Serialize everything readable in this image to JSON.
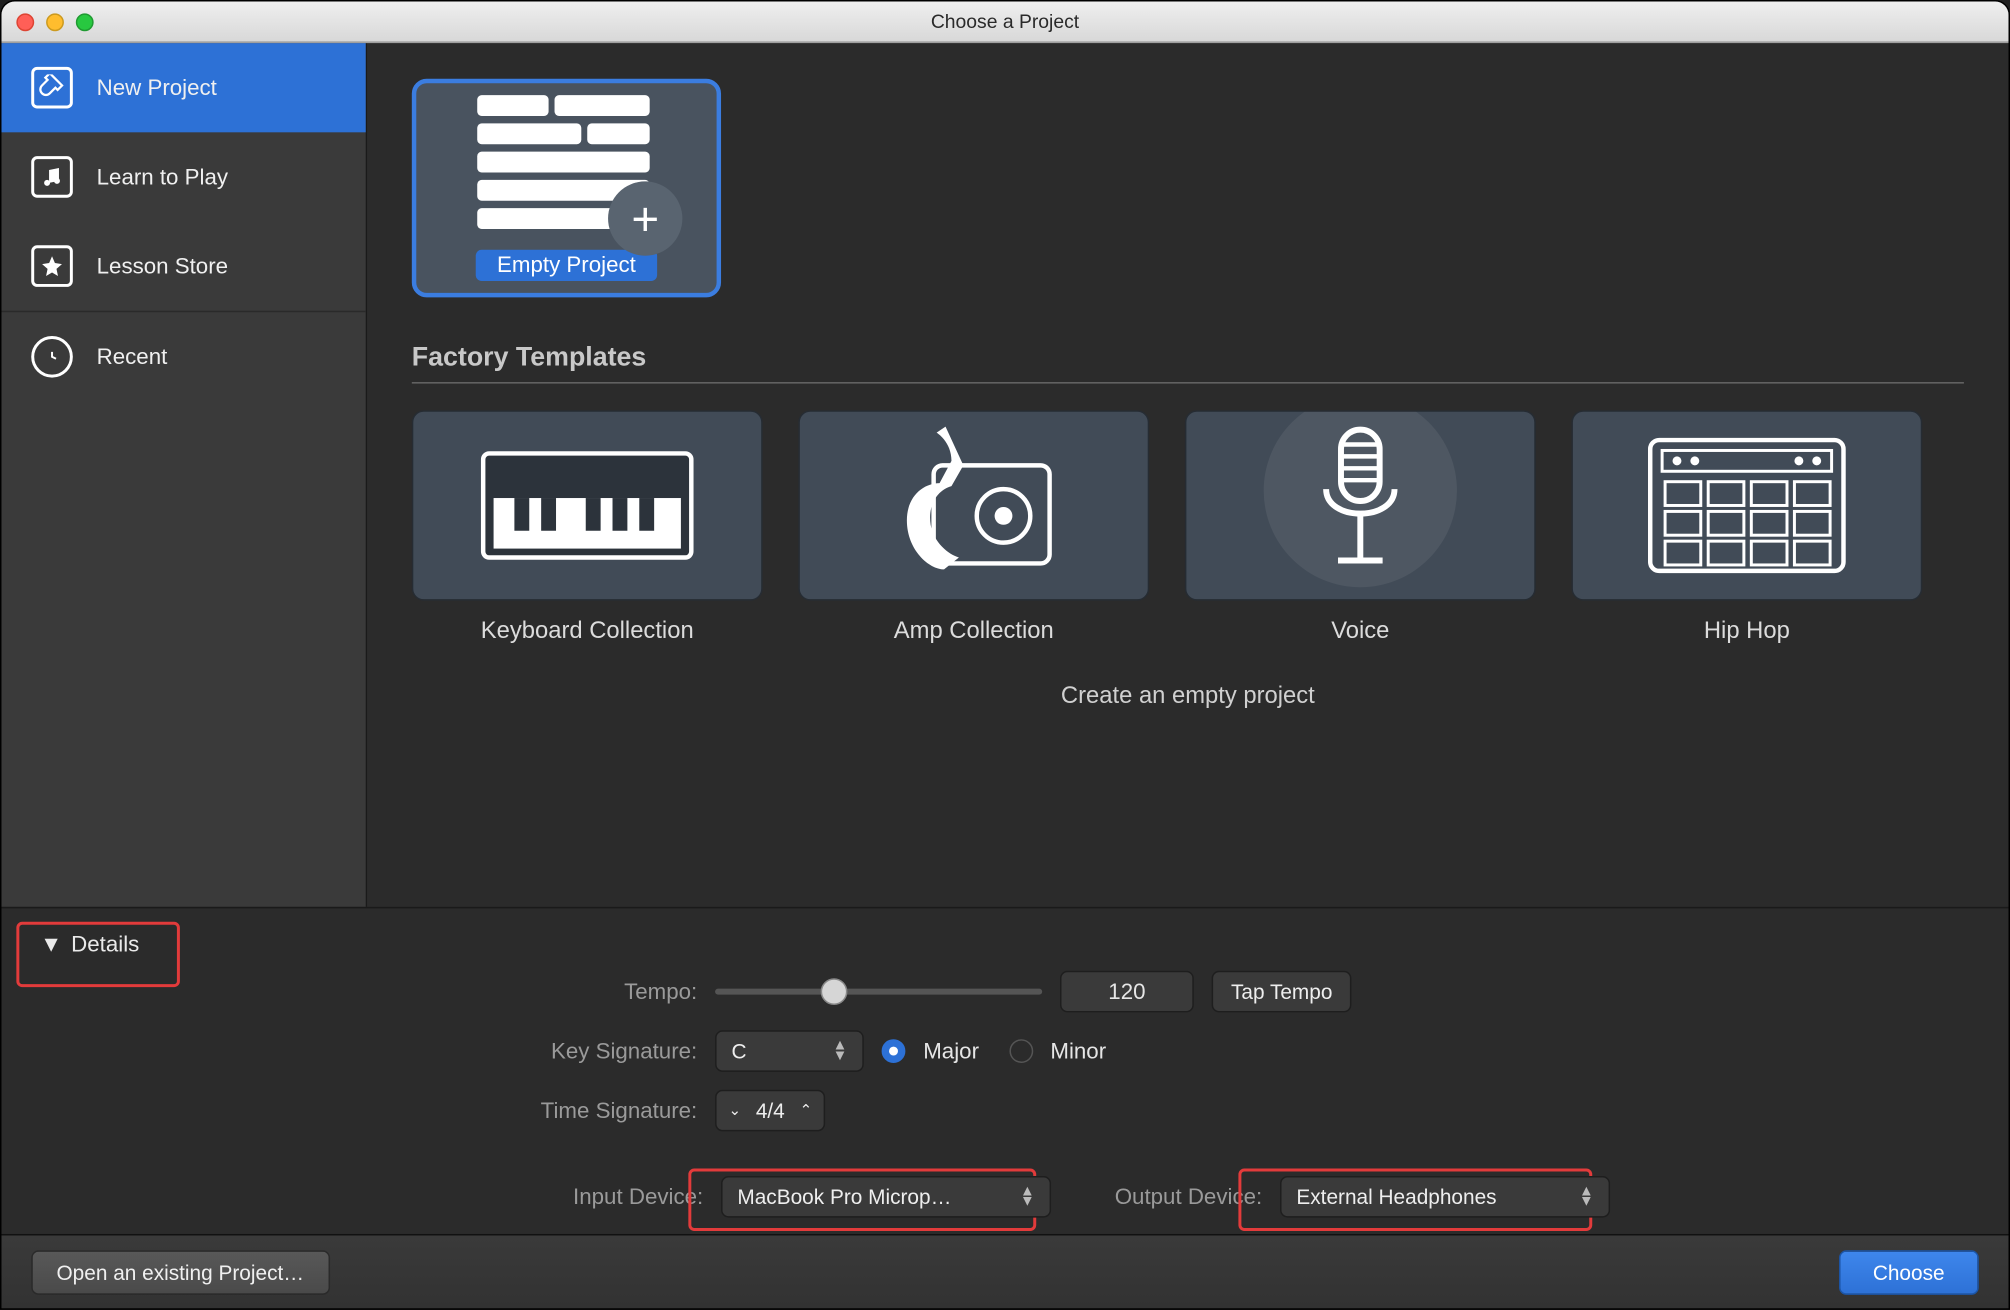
{
  "window": {
    "title": "Choose a Project"
  },
  "sidebar": {
    "items": [
      {
        "label": "New Project",
        "icon": "guitar-icon"
      },
      {
        "label": "Learn to Play",
        "icon": "note-icon"
      },
      {
        "label": "Lesson Store",
        "icon": "star-icon"
      },
      {
        "label": "Recent",
        "icon": "clock-icon"
      }
    ]
  },
  "selected_tile": {
    "label": "Empty Project"
  },
  "factory": {
    "heading": "Factory Templates",
    "templates": [
      {
        "label": "Keyboard Collection",
        "icon": "keyboard-icon"
      },
      {
        "label": "Amp Collection",
        "icon": "amp-icon"
      },
      {
        "label": "Voice",
        "icon": "mic-icon"
      },
      {
        "label": "Hip Hop",
        "icon": "drumpad-icon"
      }
    ]
  },
  "description": "Create an empty project",
  "details": {
    "toggle_label": "Details",
    "tempo_label": "Tempo:",
    "tempo_value": "120",
    "tap_tempo": "Tap Tempo",
    "key_sig_label": "Key Signature:",
    "key_value": "C",
    "major_label": "Major",
    "minor_label": "Minor",
    "time_sig_label": "Time Signature:",
    "time_value": "4/4",
    "input_label": "Input Device:",
    "input_value": "MacBook Pro Microp…",
    "output_label": "Output Device:",
    "output_value": "External Headphones"
  },
  "footer": {
    "open_existing": "Open an existing Project…",
    "choose": "Choose"
  }
}
